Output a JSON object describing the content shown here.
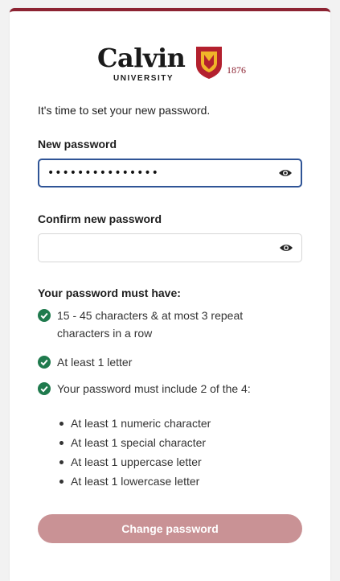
{
  "brand": {
    "name": "Calvin",
    "subtitle": "UNIVERSITY",
    "year": "1876",
    "accent_color": "#8c2332",
    "shield_color": "#b3202e",
    "shield_inner_color": "#f0b429"
  },
  "intro_text": "It's time to set your new password.",
  "new_password": {
    "label": "New password",
    "value": "•••••••••••••••",
    "toggle_icon": "eye-icon"
  },
  "confirm_password": {
    "label": "Confirm new password",
    "value": "",
    "toggle_icon": "eye-icon"
  },
  "requirements": {
    "title": "Your password must have:",
    "check_color": "#1f7a4d",
    "items": [
      "15 - 45 characters & at most 3 repeat characters in a row",
      "At least 1 letter",
      "Your password must include 2 of the 4:"
    ],
    "sub_items": [
      "At least 1 numeric character",
      "At least 1 special character",
      "At least 1 uppercase letter",
      "At least 1 lowercase letter"
    ]
  },
  "submit": {
    "label": "Change password",
    "enabled": false,
    "color": "#c99295"
  }
}
